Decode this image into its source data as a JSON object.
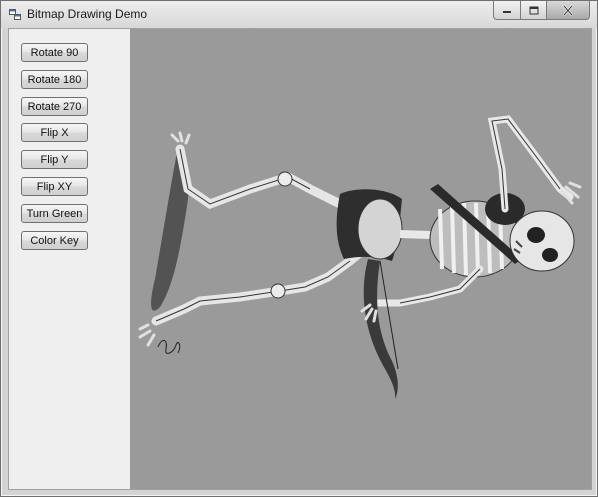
{
  "window": {
    "title": "Bitmap Drawing Demo"
  },
  "toolbar": {
    "buttons": [
      {
        "label": "Rotate 90"
      },
      {
        "label": "Rotate 180"
      },
      {
        "label": "Rotate 270"
      },
      {
        "label": "Flip X"
      },
      {
        "label": "Flip Y"
      },
      {
        "label": "Flip XY"
      },
      {
        "label": "Turn Green"
      },
      {
        "label": "Color Key"
      }
    ]
  },
  "canvas": {
    "background": "#9a9a9a",
    "image": "skeleton-archer-illustration"
  },
  "icons": {
    "app": "app-icon",
    "minimize": "minimize-icon",
    "maximize": "maximize-icon",
    "close": "close-icon"
  }
}
